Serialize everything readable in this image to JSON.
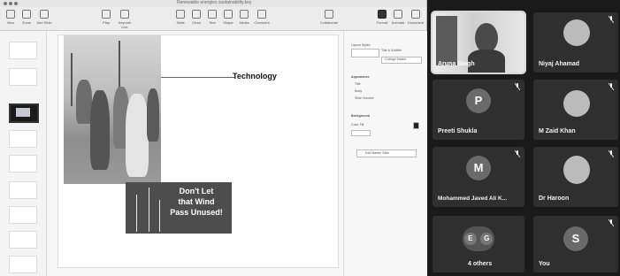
{
  "keynote": {
    "window_title": "Renewable energies sustainability.key",
    "toolbar": {
      "left": [
        "View",
        "Zoom",
        "Add Slide"
      ],
      "center": [
        "Play",
        "Keynote Live"
      ],
      "insert": [
        "Table",
        "Chart",
        "Text",
        "Shape",
        "Media",
        "Comment"
      ],
      "share": "Collaborate",
      "right": [
        "Format",
        "Animate",
        "Document"
      ]
    },
    "slide": {
      "label": "Technology",
      "banner_text": "Don't Let\nthat Wind\nPass Unused!"
    },
    "inspector": {
      "top": [
        "Layout Styles",
        "Title & Subtitle",
        "Change Master"
      ],
      "appearance_heading": "Appearance",
      "appearance_items": [
        "Title",
        "Body",
        "Slide Number"
      ],
      "background_heading": "Background",
      "background_value": "Color Fill",
      "edit_master": "Edit Master Slide"
    }
  },
  "meeting": {
    "participants": [
      {
        "name": "Aruna Singh",
        "type": "video",
        "active": true
      },
      {
        "name": "Niyaj Ahamad",
        "type": "photo",
        "muted": true
      },
      {
        "name": "Preeti Shukla",
        "type": "initial",
        "initial": "P",
        "muted": true
      },
      {
        "name": "M Zaid Khan",
        "type": "photo",
        "muted": true
      },
      {
        "name": "Mohammed Javed Ali K...",
        "type": "initial",
        "initial": "M",
        "muted": true
      },
      {
        "name": "Dr Haroon",
        "type": "photo",
        "muted": true
      },
      {
        "name": "4 others",
        "type": "group",
        "initials": [
          "E",
          "G"
        ]
      },
      {
        "name": "You",
        "type": "initial",
        "initial": "S",
        "muted": true
      }
    ]
  }
}
